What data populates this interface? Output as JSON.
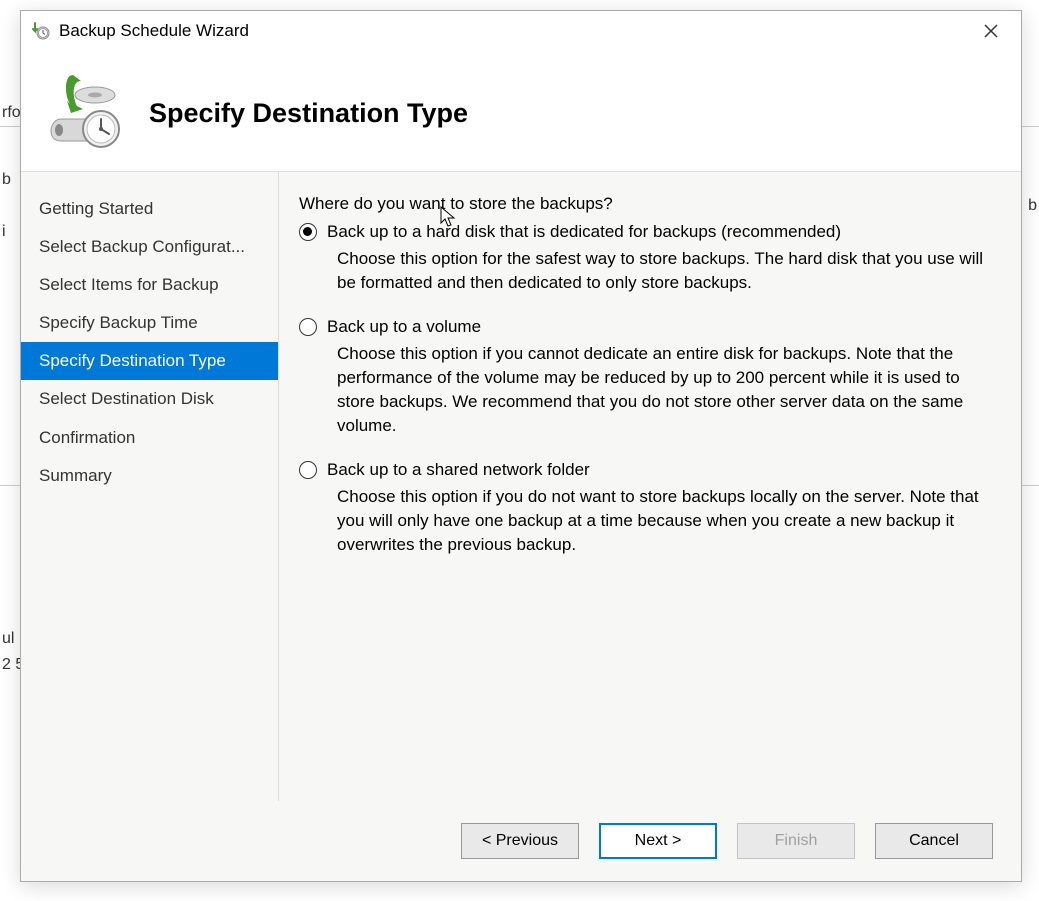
{
  "background": {
    "snippets": [
      "rfo",
      "b",
      "b",
      "i",
      "ul",
      "2 5",
      "i",
      "i"
    ]
  },
  "titlebar": {
    "title": "Backup Schedule Wizard"
  },
  "header": {
    "title": "Specify Destination Type"
  },
  "sidebar": {
    "items": [
      {
        "label": "Getting Started",
        "selected": false
      },
      {
        "label": "Select Backup Configurat...",
        "selected": false
      },
      {
        "label": "Select Items for Backup",
        "selected": false
      },
      {
        "label": "Specify Backup Time",
        "selected": false
      },
      {
        "label": "Specify Destination Type",
        "selected": true
      },
      {
        "label": "Select Destination Disk",
        "selected": false
      },
      {
        "label": "Confirmation",
        "selected": false
      },
      {
        "label": "Summary",
        "selected": false
      }
    ]
  },
  "main": {
    "question": "Where do you want to store the backups?",
    "options": [
      {
        "label": "Back up to a hard disk that is dedicated for backups (recommended)",
        "description": "Choose this option for the safest way to store backups. The hard disk that you use will be formatted and then dedicated to only store backups.",
        "checked": true
      },
      {
        "label": "Back up to a volume",
        "description": "Choose this option if you cannot dedicate an entire disk for backups. Note that the performance of the volume may be reduced by up to 200 percent while it is used to store backups. We recommend that you do not store other server data on the same volume.",
        "checked": false
      },
      {
        "label": "Back up to a shared network folder",
        "description": "Choose this option if you do not want to store backups locally on the server. Note that you will only have one backup at a time because when you create a new backup it overwrites the previous backup.",
        "checked": false
      }
    ]
  },
  "footer": {
    "previous": "< Previous",
    "next": "Next >",
    "finish": "Finish",
    "cancel": "Cancel"
  }
}
